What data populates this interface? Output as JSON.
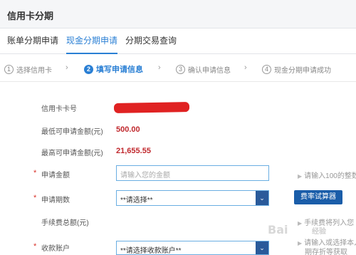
{
  "header": {
    "title": "信用卡分期"
  },
  "tabs": [
    {
      "label": "账单分期申请",
      "active": false
    },
    {
      "label": "现金分期申请",
      "active": true
    },
    {
      "label": "分期交易查询",
      "active": false
    }
  ],
  "steps": [
    {
      "num": "1",
      "label": "选择信用卡",
      "active": false
    },
    {
      "num": "2",
      "label": "填写申请信息",
      "active": true
    },
    {
      "num": "3",
      "label": "确认申请信息",
      "active": false
    },
    {
      "num": "4",
      "label": "现金分期申请成功",
      "active": false
    }
  ],
  "form": {
    "card_number_label": "信用卡卡号",
    "min_amount_label": "最低可申请金额(元)",
    "min_amount_value": "500.00",
    "max_amount_label": "最高可申请金额(元)",
    "max_amount_value": "21,655.55",
    "apply_amount_label": "申请金额",
    "apply_amount_placeholder": "请输入您的金额",
    "apply_amount_hint": "请输入100的整数",
    "period_label": "申请期数",
    "period_selected": "**请选择**",
    "calculator_label": "费率试算器",
    "fee_total_label": "手续费总额(元)",
    "fee_hint": "手续费将列入您",
    "account_label": "收款账户",
    "account_selected": "**请选择收款账户**",
    "account_hint_1": "请输入或选择本人",
    "account_hint_2": "期存折等获取",
    "required_mark": "*"
  },
  "watermark": {
    "text": "Bai",
    "sub": "经验"
  },
  "colors": {
    "accent": "#2a7fd4",
    "amount_red": "#c0282d",
    "button_blue": "#1a5da9"
  }
}
